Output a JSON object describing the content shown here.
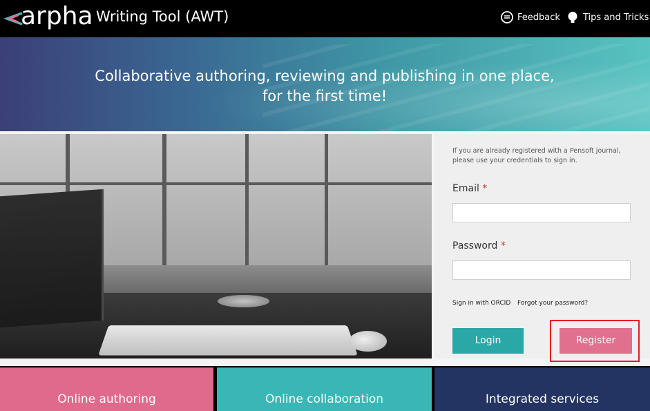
{
  "header": {
    "logo_text": "arpha",
    "app_title": "Writing Tool (AWT)",
    "nav": [
      {
        "label": "Feedback",
        "icon": "feedback-icon"
      },
      {
        "label": "Tips and Tricks",
        "icon": "bulb-icon"
      }
    ]
  },
  "hero": {
    "tagline": "Collaborative authoring, reviewing and publishing in one place, for the first time!"
  },
  "login": {
    "note": "If you are already registered with a Pensoft journal, please use your credentials to sign in.",
    "email_label": "Email",
    "email_value": "",
    "password_label": "Password",
    "password_value": "",
    "required_mark": "*",
    "orcid_link": "Sign in with ORCID",
    "forgot_link": "Forgot your password?",
    "login_button": "Login",
    "register_button": "Register"
  },
  "tiles": [
    {
      "label": "Online authoring"
    },
    {
      "label": "Online collaboration"
    },
    {
      "label": "Integrated services"
    }
  ],
  "colors": {
    "teal": "#2aa7a7",
    "pink": "#e0708e",
    "navy": "#243462",
    "highlight": "#e31b23"
  }
}
